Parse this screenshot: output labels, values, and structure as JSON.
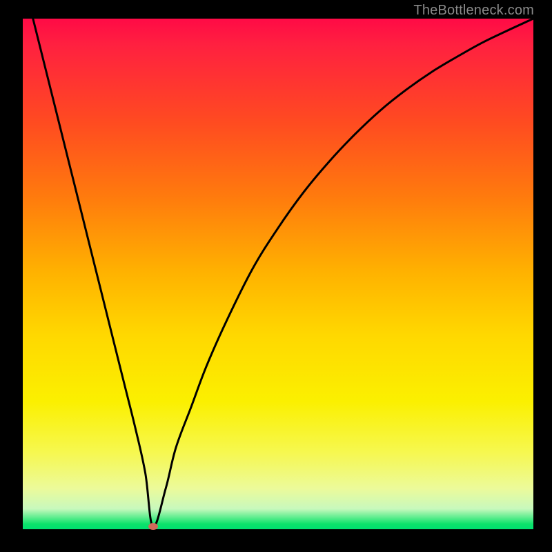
{
  "watermark": "TheBottleneck.com",
  "colors": {
    "frame": "#000000",
    "gradient_top": "#ff0a46",
    "gradient_bottom": "#00e070",
    "curve": "#000000",
    "marker": "#d06a5a",
    "watermark_text": "#8a8a8a"
  },
  "chart_data": {
    "type": "line",
    "title": "",
    "xlabel": "",
    "ylabel": "",
    "xlim": [
      0,
      100
    ],
    "ylim": [
      0,
      100
    ],
    "grid": false,
    "legend": false,
    "series": [
      {
        "name": "curve",
        "x": [
          0,
          2,
          4,
          6,
          8,
          10,
          12,
          14,
          16,
          18,
          20,
          22,
          24,
          25.5,
          28,
          30,
          33,
          36,
          40,
          45,
          50,
          55,
          60,
          65,
          70,
          75,
          80,
          85,
          90,
          95,
          100
        ],
        "values": [
          108,
          100,
          92,
          84,
          76,
          68,
          60,
          52,
          44,
          36,
          28,
          20,
          11,
          0.5,
          8,
          16,
          24,
          32,
          41,
          51,
          59,
          66,
          72,
          77.3,
          82,
          86,
          89.5,
          92.5,
          95.3,
          97.7,
          100
        ]
      }
    ],
    "marker": {
      "x": 25.5,
      "y": 0.5
    },
    "background_gradient": {
      "direction": "top-to-bottom",
      "stops": [
        {
          "pos": 0,
          "color": "#ff0a46"
        },
        {
          "pos": 20,
          "color": "#ff4a21"
        },
        {
          "pos": 50,
          "color": "#ffb300"
        },
        {
          "pos": 75,
          "color": "#fbf000"
        },
        {
          "pos": 96,
          "color": "#c8f9bd"
        },
        {
          "pos": 100,
          "color": "#00e070"
        }
      ]
    }
  }
}
